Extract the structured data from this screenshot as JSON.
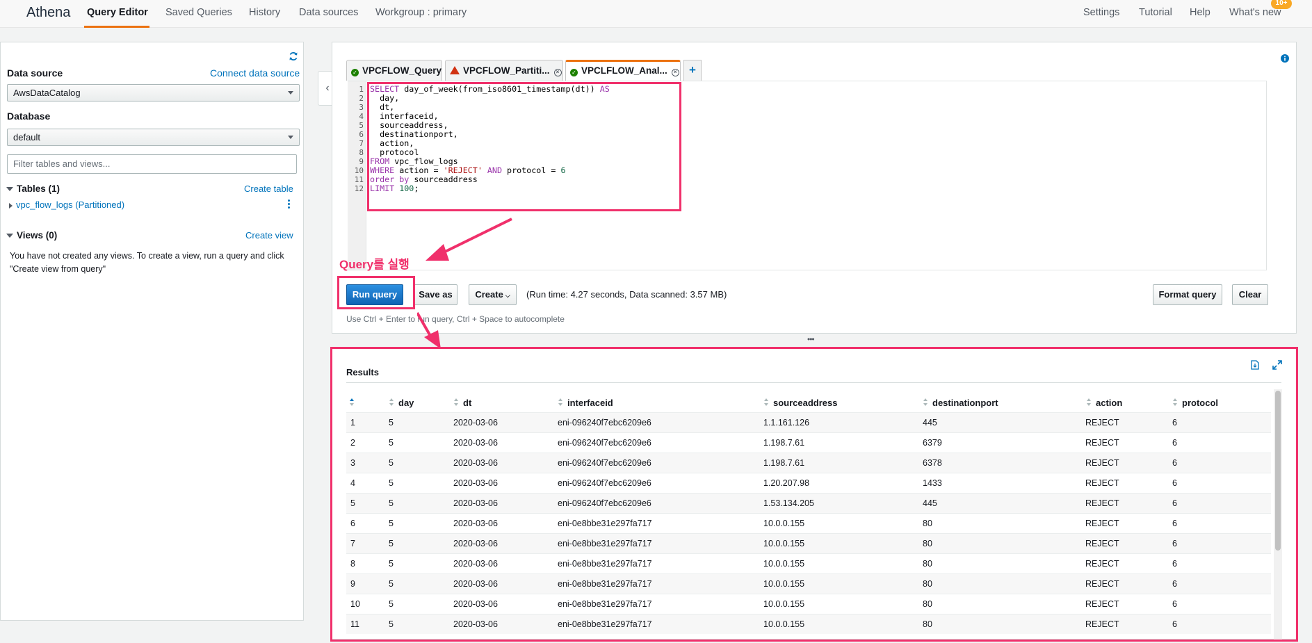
{
  "nav": {
    "brand": "Athena",
    "items": [
      "Query Editor",
      "Saved Queries",
      "History",
      "Data sources",
      "Workgroup : primary"
    ],
    "right": [
      "Settings",
      "Tutorial",
      "Help",
      "What's new"
    ],
    "badge": "10+"
  },
  "sidebar": {
    "data_source_label": "Data source",
    "connect_link": "Connect data source",
    "data_source_value": "AwsDataCatalog",
    "database_label": "Database",
    "database_value": "default",
    "filter_placeholder": "Filter tables and views...",
    "tables_header": "Tables (1)",
    "create_table": "Create table",
    "table_item": "vpc_flow_logs (Partitioned)",
    "views_header": "Views (0)",
    "create_view": "Create view",
    "views_empty": "You have not created any views. To create a view, run a query and click \"Create view from query\""
  },
  "editor": {
    "tabs": [
      "VPCFLOW_Query",
      "VPCFLOW_Partiti...",
      "VPCLFLOW_Anal..."
    ],
    "line_numbers": [
      "1",
      "2",
      "3",
      "4",
      "5",
      "6",
      "7",
      "8",
      "9",
      "10",
      "11",
      "12"
    ],
    "code": {
      "l1_kw1": "SELECT",
      "l1_mid": " day_of_week(from_iso8601_timestamp(dt)) ",
      "l1_kw2": "AS",
      "l2": "  day,",
      "l3": "  dt,",
      "l4": "  interfaceid,",
      "l5": "  sourceaddress,",
      "l6": "  destinationport,",
      "l7": "  action,",
      "l8": "  protocol",
      "l9_kw": "FROM",
      "l9_rest": " vpc_flow_logs",
      "l10_kw": "WHERE",
      "l10_a": " action = ",
      "l10_str": "'REJECT'",
      "l10_kw2": " AND",
      "l10_b": " protocol = ",
      "l10_num": "6",
      "l11_kw": "order by",
      "l11_rest": " sourceaddress",
      "l12_kw": "LIMIT",
      "l12_num": " 100",
      "l12_end": ";"
    },
    "buttons": {
      "run": "Run query",
      "save_as": "Save as",
      "create": "Create",
      "format": "Format query",
      "clear": "Clear"
    },
    "run_info": "(Run time: 4.27 seconds, Data scanned: 3.57 MB)",
    "hint": "Use Ctrl + Enter to run query, Ctrl + Space to autocomplete",
    "annotation": "Query를 실행"
  },
  "results": {
    "title": "Results",
    "columns": [
      "day",
      "dt",
      "interfaceid",
      "sourceaddress",
      "destinationport",
      "action",
      "protocol"
    ],
    "rows": [
      [
        "1",
        "5",
        "2020-03-06",
        "eni-096240f7ebc6209e6",
        "1.1.161.126",
        "445",
        "REJECT",
        "6"
      ],
      [
        "2",
        "5",
        "2020-03-06",
        "eni-096240f7ebc6209e6",
        "1.198.7.61",
        "6379",
        "REJECT",
        "6"
      ],
      [
        "3",
        "5",
        "2020-03-06",
        "eni-096240f7ebc6209e6",
        "1.198.7.61",
        "6378",
        "REJECT",
        "6"
      ],
      [
        "4",
        "5",
        "2020-03-06",
        "eni-096240f7ebc6209e6",
        "1.20.207.98",
        "1433",
        "REJECT",
        "6"
      ],
      [
        "5",
        "5",
        "2020-03-06",
        "eni-096240f7ebc6209e6",
        "1.53.134.205",
        "445",
        "REJECT",
        "6"
      ],
      [
        "6",
        "5",
        "2020-03-06",
        "eni-0e8bbe31e297fa717",
        "10.0.0.155",
        "80",
        "REJECT",
        "6"
      ],
      [
        "7",
        "5",
        "2020-03-06",
        "eni-0e8bbe31e297fa717",
        "10.0.0.155",
        "80",
        "REJECT",
        "6"
      ],
      [
        "8",
        "5",
        "2020-03-06",
        "eni-0e8bbe31e297fa717",
        "10.0.0.155",
        "80",
        "REJECT",
        "6"
      ],
      [
        "9",
        "5",
        "2020-03-06",
        "eni-0e8bbe31e297fa717",
        "10.0.0.155",
        "80",
        "REJECT",
        "6"
      ],
      [
        "10",
        "5",
        "2020-03-06",
        "eni-0e8bbe31e297fa717",
        "10.0.0.155",
        "80",
        "REJECT",
        "6"
      ],
      [
        "11",
        "5",
        "2020-03-06",
        "eni-0e8bbe31e297fa717",
        "10.0.0.155",
        "80",
        "REJECT",
        "6"
      ]
    ]
  },
  "colors": {
    "accent": "#ec7211",
    "link": "#0073bb",
    "annotation": "#f0306b",
    "primary_button": "#1a73c8"
  }
}
